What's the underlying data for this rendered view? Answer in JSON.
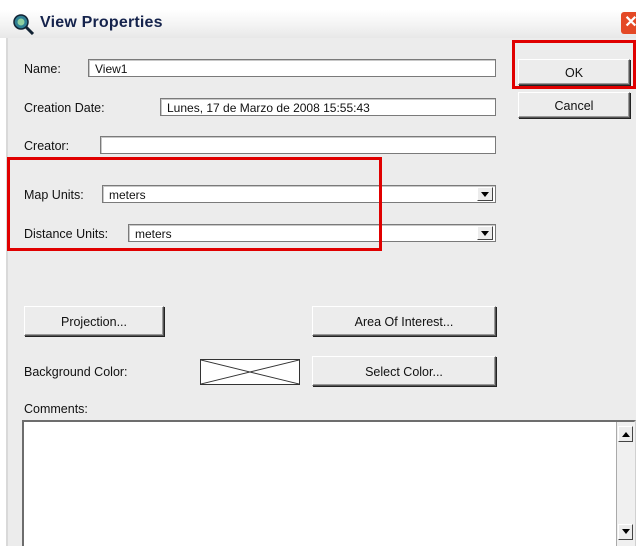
{
  "window": {
    "title": "View Properties",
    "close_glyph": "✕",
    "icon": "view-magnifier-icon"
  },
  "form": {
    "name_label": "Name:",
    "name_value": "View1",
    "creation_date_label": "Creation Date:",
    "creation_date_value": "Lunes, 17 de Marzo de 2008 15:55:43",
    "creator_label": "Creator:",
    "creator_value": "",
    "map_units_label": "Map Units:",
    "map_units_value": "meters",
    "distance_units_label": "Distance Units:",
    "distance_units_value": "meters",
    "background_color_label": "Background Color:",
    "comments_label": "Comments:",
    "comments_value": ""
  },
  "buttons": {
    "ok": "OK",
    "cancel": "Cancel",
    "projection": "Projection...",
    "area_of_interest": "Area Of Interest...",
    "select_color": "Select Color..."
  },
  "highlight_color": "#e00000"
}
